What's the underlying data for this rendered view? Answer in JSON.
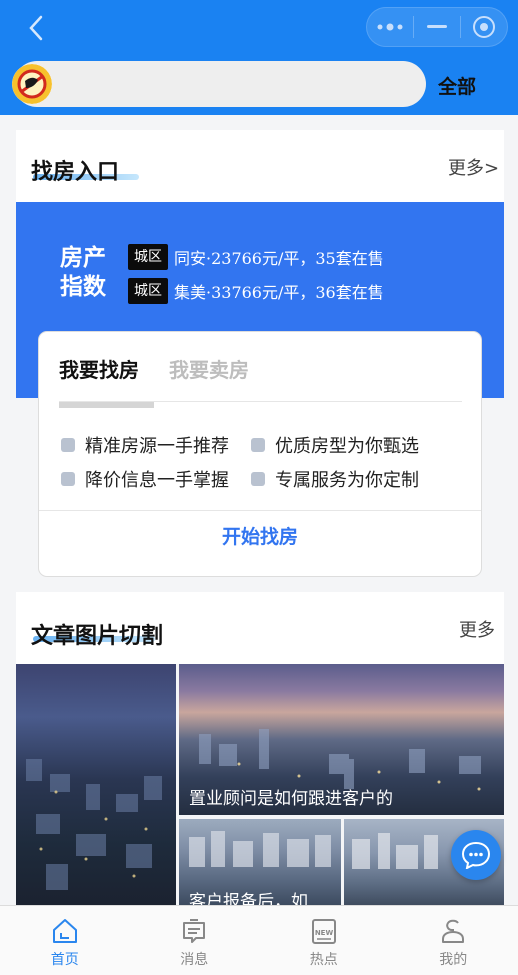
{
  "search": {
    "value": "",
    "placeholder": ""
  },
  "header": {
    "all_label": "全部"
  },
  "find_entry": {
    "title": "找房入口",
    "more": "更多>"
  },
  "price_index": {
    "title_line1": "房产",
    "title_line2": "指数",
    "rows": [
      {
        "tag": "城区",
        "text": "同安·23766元/平，35套在售"
      },
      {
        "tag": "城区",
        "text": "集美·33766元/平，36套在售"
      }
    ]
  },
  "find_card": {
    "tab_active": "我要找房",
    "tab_inactive": "我要卖房",
    "features": [
      "精准房源一手推荐",
      "优质房型为你甄选",
      "降价信息一手掌握",
      "专属服务为你定制"
    ],
    "button": "开始找房"
  },
  "articles": {
    "title": "文章图片切割",
    "more": "更多",
    "captions": [
      "置业顾问是如何跟进客户的",
      "客户报备后，如"
    ]
  },
  "tabbar": {
    "items": [
      {
        "label": "首页",
        "icon": "home-icon",
        "active": true
      },
      {
        "label": "消息",
        "icon": "message-icon"
      },
      {
        "label": "热点",
        "icon": "news-icon"
      },
      {
        "label": "我的",
        "icon": "profile-icon"
      }
    ]
  },
  "colors": {
    "header": "#1a82f2",
    "accent": "#3275f0",
    "tag": "#0b0b0b"
  }
}
